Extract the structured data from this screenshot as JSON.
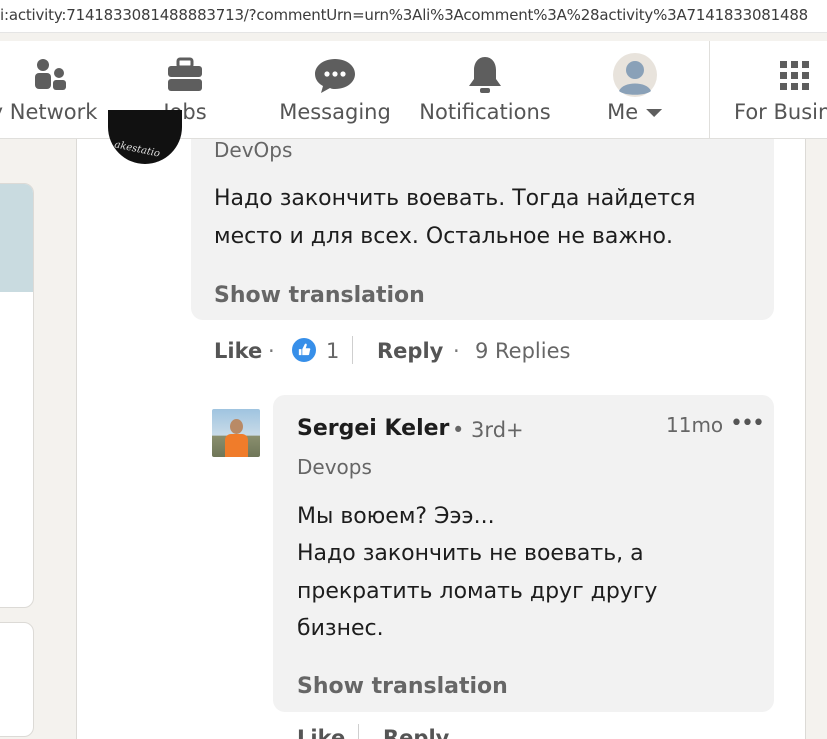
{
  "browser": {
    "url": "i:activity:7141833081488883713/?commentUrn=urn%3Ali%3Acomment%3A%28activity%3A7141833081488"
  },
  "nav": {
    "items": [
      {
        "label": "My Network",
        "icon": "people-icon"
      },
      {
        "label": "Jobs",
        "icon": "briefcase-icon"
      },
      {
        "label": "Messaging",
        "icon": "chat-icon"
      },
      {
        "label": "Notifications",
        "icon": "bell-icon"
      },
      {
        "label": "Me",
        "icon": "avatar-icon"
      },
      {
        "label": "For Business",
        "icon": "grid-icon"
      }
    ]
  },
  "comment1": {
    "avatar_text": "akestatio",
    "headline": "DevOps",
    "text_line1": "Надо закончить воевать. Тогда найдется",
    "text_line2": "место и для всех. Остальное не важно.",
    "show_translation": "Show translation",
    "like_label": "Like",
    "reaction_count": "1",
    "reply_label": "Reply",
    "replies_label": "9 Replies"
  },
  "reply1": {
    "author": "Sergei Keler",
    "degree": "• 3rd+",
    "time": "11mo",
    "more": "•••",
    "headline": "Devops",
    "line1": "Мы воюем? Эээ...",
    "line2": "Надо закончить не воевать, а",
    "line3": "прекратить ломать друг другу",
    "line4": "бизнес.",
    "show_translation": "Show translation",
    "like_label": "Like",
    "reply_label": "Reply"
  },
  "colors": {
    "accent": "#378fe9",
    "bubble": "#f2f2f2",
    "muted_text": "#666666",
    "banner": "#c9dbe0"
  }
}
